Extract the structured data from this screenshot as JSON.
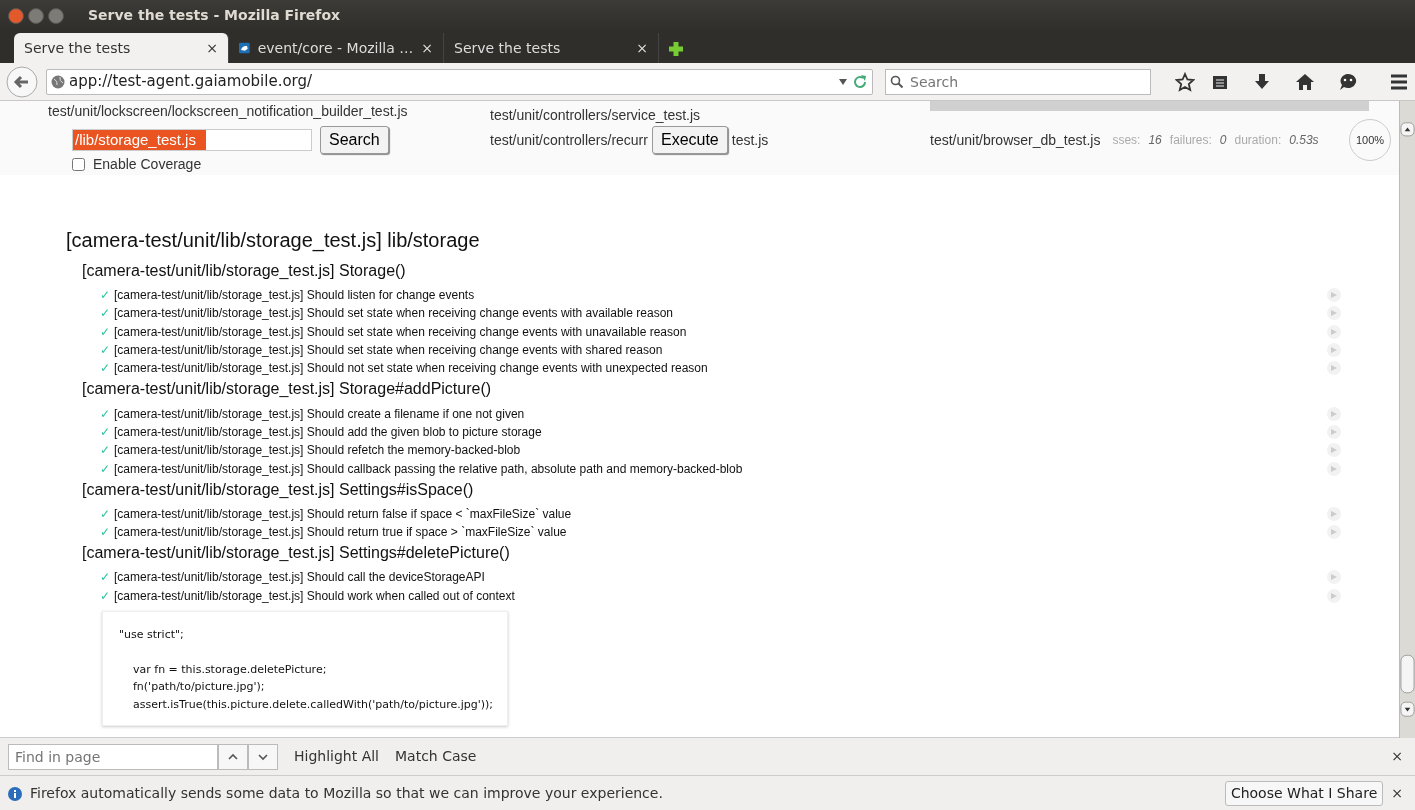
{
  "window": {
    "title": "Serve the tests - Mozilla Firefox"
  },
  "tabs": [
    {
      "label": "Serve the tests",
      "selected": true,
      "close": "×",
      "kind": "plain"
    },
    {
      "label": "event/core - Mozilla …",
      "selected": false,
      "close": "×",
      "kind": "site"
    },
    {
      "label": "Serve the tests",
      "selected": false,
      "close": "×",
      "kind": "plain"
    }
  ],
  "address_bar": {
    "value": "app://test-agent.gaiamobile.org/"
  },
  "search_field": {
    "placeholder": "Search"
  },
  "runner": {
    "left_files": [
      "test/unit/lockscreen/lockscreen_notification_builder_test.js"
    ],
    "search_value": "/lib/storage_test.js",
    "search_button": "Search",
    "coverage": {
      "label": "Enable Coverage",
      "checked": false
    },
    "middle_files": [
      "test/unit/controllers/service_test.js"
    ],
    "middle_cut": "test/unit/controllers/recurr",
    "execute_button": "Execute",
    "middle_tail": "test.js",
    "right_file": "test/unit/browser_db_test.js",
    "stats": [
      {
        "label": "sses:",
        "value": "16"
      },
      {
        "label": "failures:",
        "value": "0"
      },
      {
        "label": "duration:",
        "value": "0.53",
        "unit": "s"
      }
    ],
    "progress": "100%"
  },
  "report": {
    "title": "[camera-test/unit/lib/storage_test.js] lib/storage",
    "suites": [
      {
        "title": "[camera-test/unit/lib/storage_test.js] Storage()",
        "tests": [
          {
            "mark": "✓",
            "passed": true,
            "text": "[camera-test/unit/lib/storage_test.js] Should listen for change events"
          },
          {
            "mark": "✓",
            "passed": true,
            "text": "[camera-test/unit/lib/storage_test.js] Should set state when receiving change events with available reason"
          },
          {
            "mark": "✓",
            "passed": true,
            "text": "[camera-test/unit/lib/storage_test.js] Should set state when receiving change events with unavailable reason"
          },
          {
            "mark": "✓",
            "passed": true,
            "text": "[camera-test/unit/lib/storage_test.js] Should set state when receiving change events with shared reason"
          },
          {
            "mark": "✓",
            "passed": true,
            "text": "[camera-test/unit/lib/storage_test.js] Should not set state when receiving change events with unexpected reason"
          }
        ]
      },
      {
        "title": "[camera-test/unit/lib/storage_test.js] Storage#addPicture()",
        "tests": [
          {
            "mark": "✓",
            "passed": true,
            "text": "[camera-test/unit/lib/storage_test.js] Should create a filename if one not given"
          },
          {
            "mark": "✓",
            "passed": true,
            "text": "[camera-test/unit/lib/storage_test.js] Should add the given blob to picture storage"
          },
          {
            "mark": "✓",
            "passed": true,
            "text": "[camera-test/unit/lib/storage_test.js] Should refetch the memory-backed-blob"
          },
          {
            "mark": "✓",
            "passed": true,
            "text": "[camera-test/unit/lib/storage_test.js] Should callback passing the relative path, absolute path and memory-backed-blob"
          }
        ]
      },
      {
        "title": "[camera-test/unit/lib/storage_test.js] Settings#isSpace()",
        "tests": [
          {
            "mark": "✓",
            "passed": true,
            "text": "[camera-test/unit/lib/storage_test.js] Should return false if space < `maxFileSize` value"
          },
          {
            "mark": "✓",
            "passed": true,
            "text": "[camera-test/unit/lib/storage_test.js] Should return true if space > `maxFileSize` value"
          }
        ]
      },
      {
        "title": "[camera-test/unit/lib/storage_test.js] Settings#deletePicture()",
        "tests": [
          {
            "mark": "✓",
            "passed": true,
            "text": "[camera-test/unit/lib/storage_test.js] Should call the deviceStorageAPI"
          },
          {
            "mark": "✓",
            "passed": true,
            "text": "[camera-test/unit/lib/storage_test.js] Should work when called out of context"
          }
        ]
      }
    ],
    "code": {
      "head": "\"use strict\";",
      "body": [
        "var fn = this.storage.deletePicture;",
        "fn('path/to/picture.jpg');",
        "assert.isTrue(this.picture.delete.calledWith('path/to/picture.jpg'));"
      ]
    }
  },
  "find_bar": {
    "placeholder": "Find in page",
    "options": [
      "Highlight All",
      "Match Case"
    ],
    "close": "×"
  },
  "notification": {
    "text": "Firefox automatically sends some data to Mozilla so that we can improve your experience.",
    "button": "Choose What I Share",
    "close": "×"
  }
}
